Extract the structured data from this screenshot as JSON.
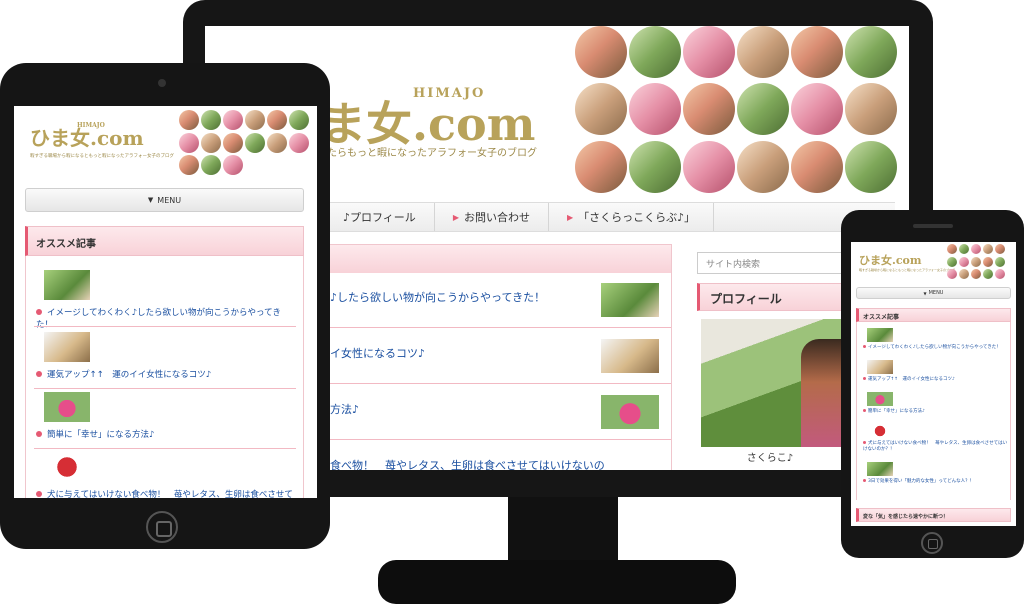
{
  "site": {
    "logo": "ひま女.com",
    "logo_sub": "HIMAJO",
    "tagline_monitor": "たらもっと暇になったアラフォー女子のブログ",
    "tagline_small": "暇すぎる職場から暇になるともっと暇になったアラフォー女子のブログ"
  },
  "monitor": {
    "logo_visible": "ま女.com",
    "nav": [
      "♪プロフィール",
      "お問い合わせ",
      "「さくらっこくらぶ♪」"
    ],
    "posts": [
      "♪したら欲しい物が向こうからやってきた！",
      "イ女性になるコツ♪",
      "方法♪",
      "食べ物！　苺やレタス、生卵は食べさせてはいけないの"
    ],
    "search_placeholder": "サイト内検索",
    "profile_heading": "プロフィール",
    "profile_name": "さくらこ♪"
  },
  "tablet": {
    "menu_label": "MENU",
    "section_title": "オススメ記事",
    "posts": [
      "イメージしてわくわく♪したら欲しい物が向こうからやってきた！",
      "運気アップ↑↑　運のイイ女性になるコツ♪",
      "簡単に「幸せ」になる方法♪",
      "犬に与えてはいけない食べ物！　苺やレタス、生卵は食べさせてはいけないのか？！"
    ]
  },
  "phone": {
    "menu_label": "MENU",
    "section_title": "オススメ記事",
    "posts": [
      "イメージしてわくわく♪したら欲しい物が向こうからやってきた！",
      "運気アップ↑↑　運のイイ女性になるコツ♪",
      "簡単に「幸せ」になる方法♪",
      "犬に与えてはいけない食べ物！　苺やレタス、生卵は食べさせてはいけないのか？！",
      "3日で効果を得い「魅力的な女性」ってどんな人？！"
    ],
    "footer_text": "変な「気」を感じたら速やかに断つ！"
  },
  "icons": {
    "menu_chevron": "chevron-down-icon",
    "nav_arrow": "triangle-right-icon"
  },
  "colors": {
    "accent": "#e55a73",
    "link": "#1a4fa0",
    "logo_gold": "#b8a25a",
    "frame": "#151515"
  }
}
